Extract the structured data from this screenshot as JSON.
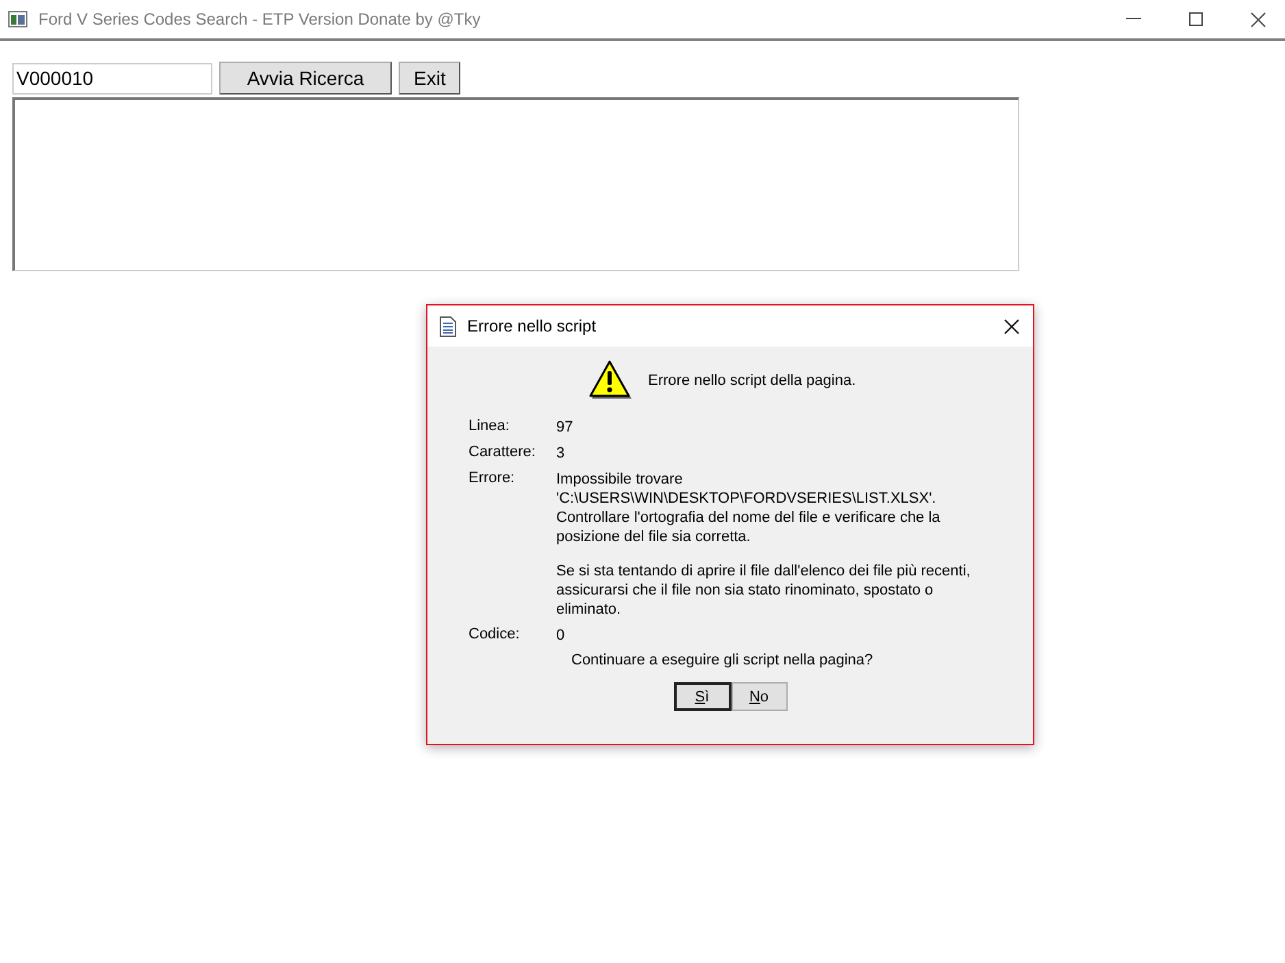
{
  "window": {
    "title": "Ford V Series Codes Search - ETP Version Donate by @Tky"
  },
  "search": {
    "value": "V000010"
  },
  "buttons": [
    {
      "label": "Avvia Ricerca"
    },
    {
      "label": "Exit"
    }
  ],
  "dialog": {
    "title": "Errore nello script",
    "heading": "Errore nello script della pagina.",
    "fields": [
      {
        "label": "Linea:",
        "value": "97"
      },
      {
        "label": "Carattere:",
        "value": "3"
      },
      {
        "label": "Errore:",
        "value": "Impossibile trovare 'C:\\USERS\\WIN\\DESKTOP\\FORDVSERIES\\LIST.XLSX'. Controllare l'ortografia del nome del file e verificare che la posizione del file sia corretta.",
        "note": "Se si sta tentando di aprire il file dall'elenco dei file più recenti, assicurarsi che il file non sia stato rinominato, spostato o eliminato."
      },
      {
        "label": "Codice:",
        "value": "0"
      }
    ],
    "question": "Continuare a eseguire gli script nella pagina?",
    "buttons": [
      {
        "label": "Sì",
        "selected": true
      },
      {
        "label": "No",
        "selected": false
      }
    ]
  }
}
